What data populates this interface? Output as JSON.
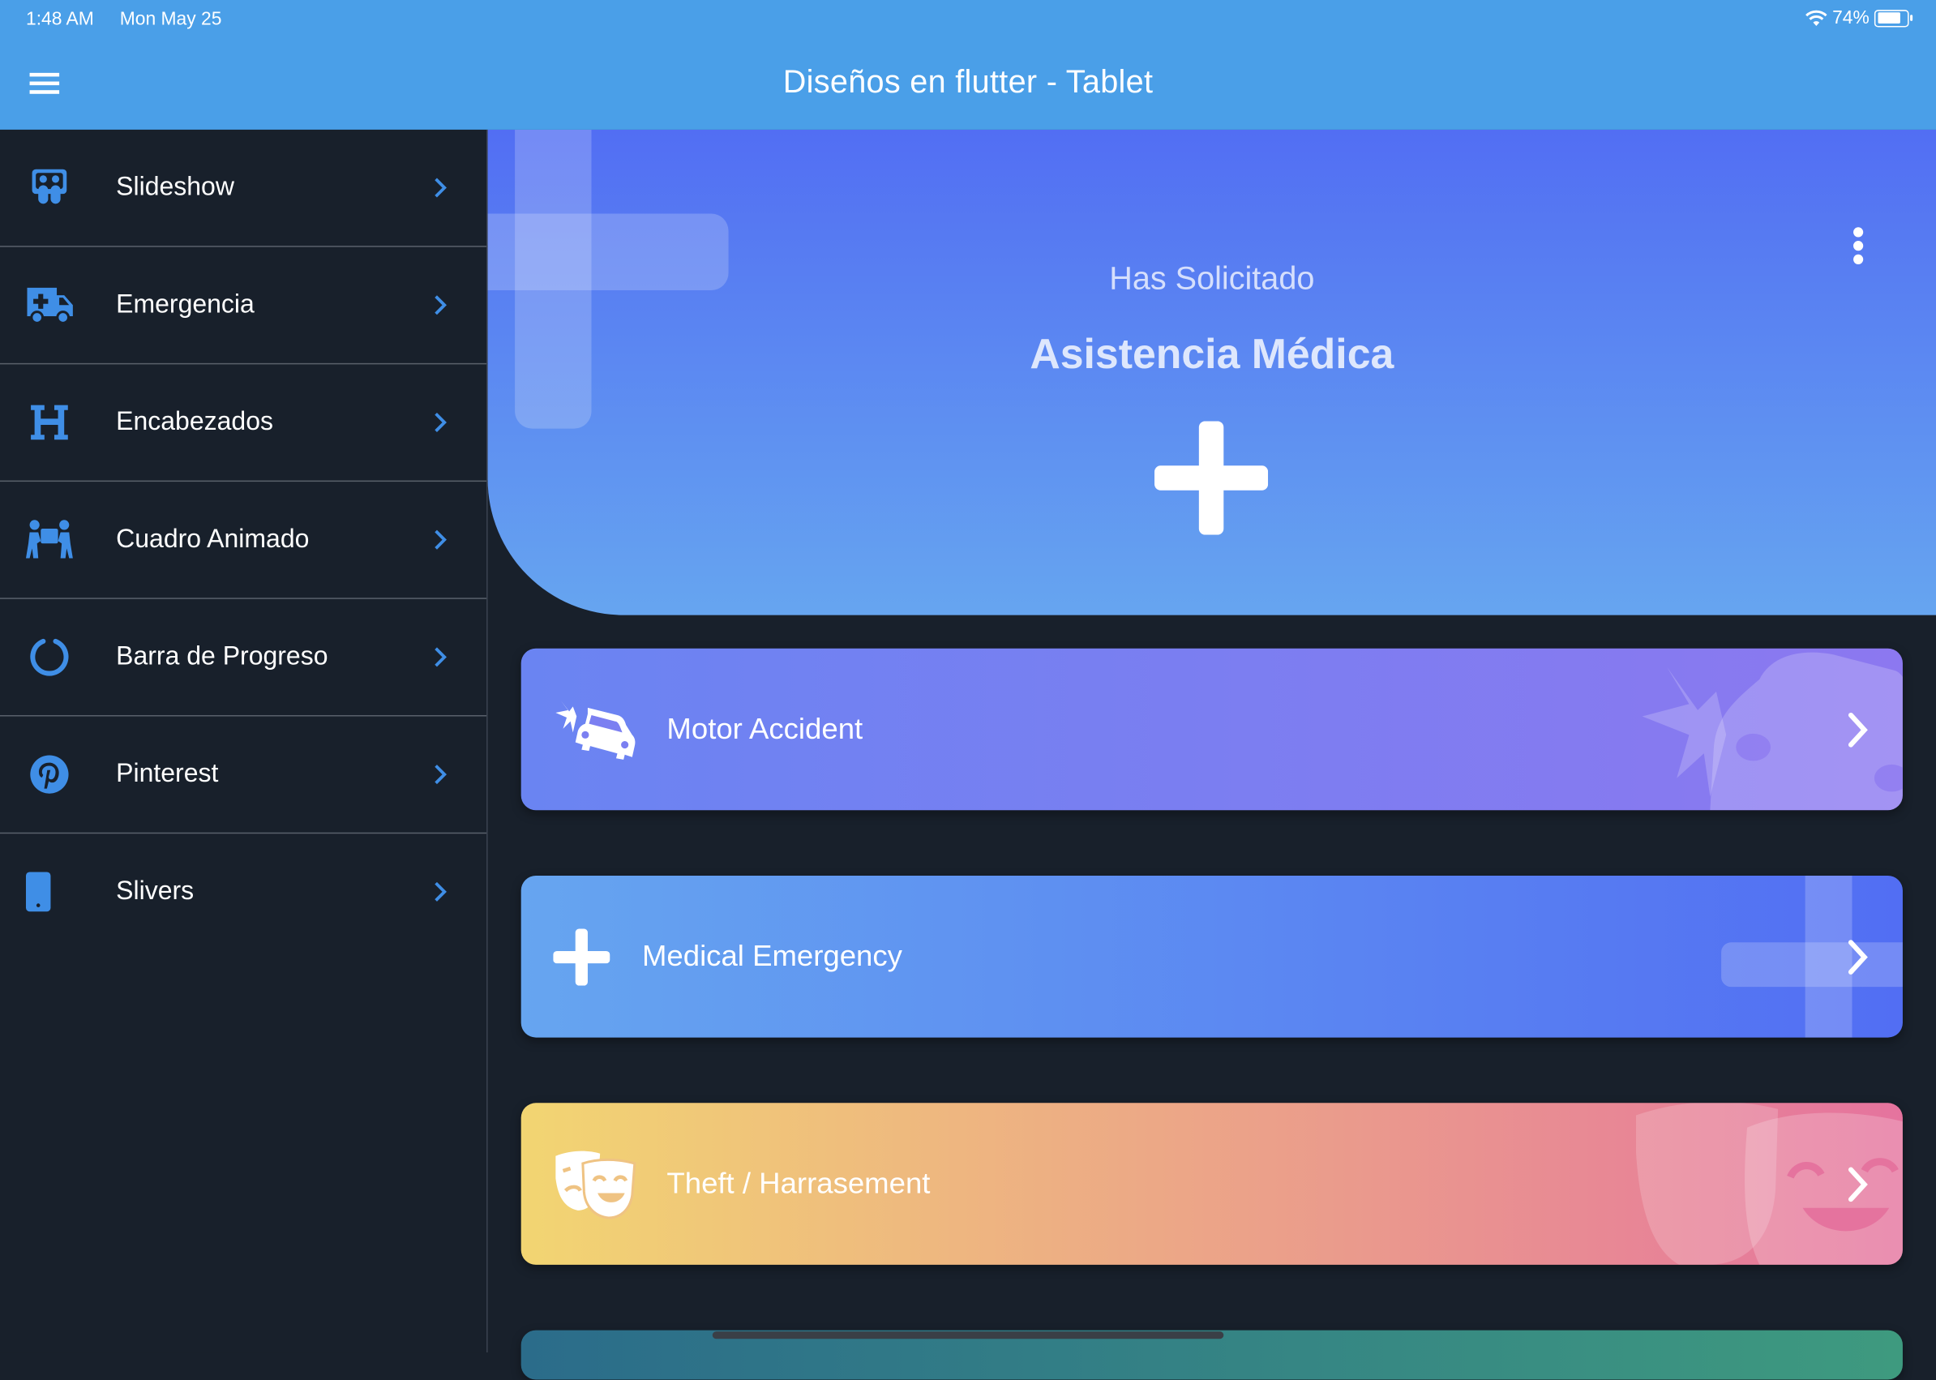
{
  "status_bar": {
    "time": "1:48 AM",
    "date": "Mon May 25",
    "battery": "74%"
  },
  "app_bar": {
    "title": "Diseños en flutter - Tablet"
  },
  "sidebar": {
    "items": [
      {
        "label": "Slideshow",
        "icon": "slideshare-icon"
      },
      {
        "label": "Emergencia",
        "icon": "ambulance-icon"
      },
      {
        "label": "Encabezados",
        "icon": "heading-icon"
      },
      {
        "label": "Cuadro Animado",
        "icon": "people-carry-icon"
      },
      {
        "label": "Barra de Progreso",
        "icon": "circle-notch-icon"
      },
      {
        "label": "Pinterest",
        "icon": "pinterest-icon"
      },
      {
        "label": "Slivers",
        "icon": "mobile-icon"
      }
    ]
  },
  "header": {
    "subtitle": "Has Solicitado",
    "title": "Asistencia Médica"
  },
  "cards": [
    {
      "label": "Motor Accident",
      "icon": "car-crash-icon",
      "color_start": "#6a84f2",
      "color_end": "#8c78f0"
    },
    {
      "label": "Medical Emergency",
      "icon": "plus-icon",
      "color_start": "#66a5f0",
      "color_end": "#526ef3"
    },
    {
      "label": "Theft / Harrasement",
      "icon": "theater-masks-icon",
      "color_start": "#f2d572",
      "color_end": "#e5739e"
    }
  ],
  "colors": {
    "accent": "#4a9fe8",
    "icon_blue": "#3f8ee6",
    "background": "#18202b"
  }
}
